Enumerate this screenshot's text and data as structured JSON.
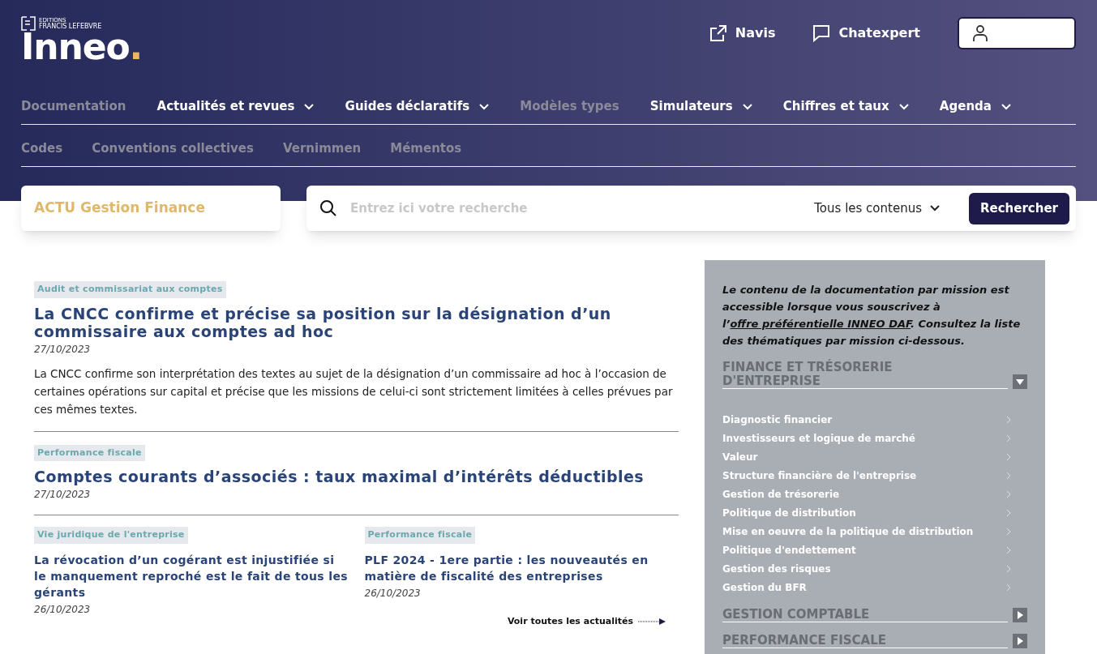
{
  "brand": {
    "publisher_line1": "EDITIONS",
    "publisher_line2": "FRANCIS LEFEBVRE",
    "logo": "Inneo",
    "logo_dot": "."
  },
  "top_links": [
    {
      "kind": "external",
      "label": "Navis"
    },
    {
      "kind": "chat",
      "label": "Chatexpert"
    }
  ],
  "nav_rows": [
    [
      {
        "label": "Documentation",
        "disabled": true,
        "dropdown": false
      },
      {
        "label": "Actualités et revues",
        "disabled": false,
        "dropdown": true
      },
      {
        "label": "Guides déclaratifs",
        "disabled": false,
        "dropdown": true
      },
      {
        "label": "Modèles types",
        "disabled": true,
        "dropdown": false
      },
      {
        "label": "Simulateurs",
        "disabled": false,
        "dropdown": true
      },
      {
        "label": "Chiffres et taux",
        "disabled": false,
        "dropdown": true
      },
      {
        "label": "Agenda",
        "disabled": false,
        "dropdown": true
      }
    ],
    [
      {
        "label": "Codes",
        "disabled": true,
        "dropdown": false
      },
      {
        "label": "Conventions collectives",
        "disabled": true,
        "dropdown": false
      },
      {
        "label": "Vernimmen",
        "disabled": true,
        "dropdown": false
      },
      {
        "label": "Mémentos",
        "disabled": true,
        "dropdown": false
      }
    ]
  ],
  "section_title": "ACTU Gestion Finance",
  "search": {
    "placeholder": "Entrez ici votre recherche",
    "scope": "Tous les contenus",
    "button": "Rechercher"
  },
  "articles": [
    {
      "tag": "Audit et commissariat aux comptes",
      "title": "La CNCC confirme et précise sa position sur la désignation d’un commissaire aux comptes ad hoc",
      "date": "27/10/2023",
      "summary": "La CNCC confirme son interprétation des textes au sujet de la désignation d’un commissaire ad hoc à l’occasion de certaines opérations sur capital et précise que les missions de celui-ci sont strictement limitées à celles prévues par ces mêmes textes."
    },
    {
      "tag": "Performance fiscale",
      "title": "Comptes courants d’associés : taux maximal d’intérêts déductibles",
      "date": "27/10/2023"
    }
  ],
  "small_articles": [
    {
      "tag": "Vie juridique de l'entreprise",
      "title": "La révocation d’un cogérant est injustifiée si le manquement reproché est le fait de tous les gérants",
      "date": "26/10/2023"
    },
    {
      "tag": "Performance fiscale",
      "title": "PLF 2024 - 1ere partie : les nouveautés en matière de fiscalité des entreprises",
      "date": "26/10/2023"
    }
  ],
  "see_all": "Voir toutes les actualités",
  "sidebar": {
    "intro_before": "Le contenu de la documentation par mission est accessible lorsque vous souscrivez à l’",
    "intro_link": "offre préférentielle INNEO DAF",
    "intro_after": ". Consultez la liste des thématiques par mission ci-dessous.",
    "sections": [
      {
        "title": "FINANCE ET TRÉSORERIE D'ENTREPRISE",
        "expanded": true,
        "items": [
          "Diagnostic financier",
          "Investisseurs et logique de marché",
          "Valeur",
          "Structure financière de l'entreprise",
          "Gestion de trésorerie",
          "Politique de distribution",
          "Mise en oeuvre de la politique de distribution",
          "Politique d'endettement",
          "Gestion des risques",
          "Gestion du BFR"
        ]
      },
      {
        "title": "GESTION COMPTABLE",
        "expanded": false
      },
      {
        "title": "PERFORMANCE FISCALE",
        "expanded": false
      }
    ]
  }
}
